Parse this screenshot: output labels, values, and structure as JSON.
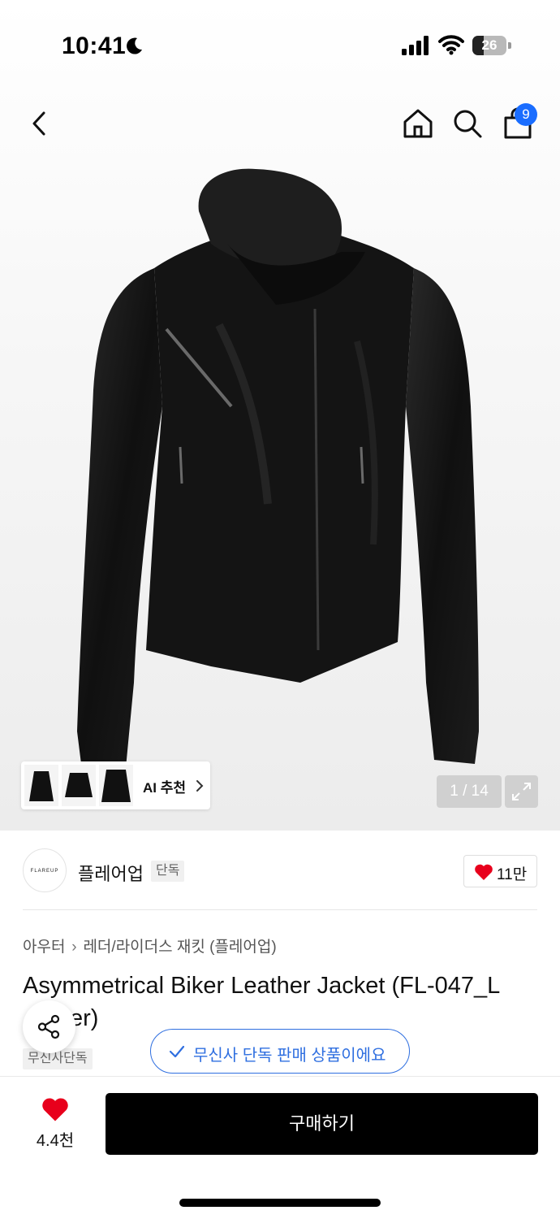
{
  "status_bar": {
    "time": "10:41",
    "battery": "26"
  },
  "nav": {
    "cart_count": "9"
  },
  "gallery": {
    "ai_recommend_label": "AI 추천",
    "page_counter": "1 / 14"
  },
  "brand": {
    "logo_text": "FLAREUP",
    "name": "플레어업",
    "tag": "단독",
    "like_count": "11만"
  },
  "product": {
    "breadcrumb": [
      "아우터",
      "레더/라이더스 재킷 (플레어업)"
    ],
    "title_line1": "Asymmetrical Biker Leather Jacket (FL-047_L",
    "title_line2": "er)",
    "exclusive_tag": "무신사단독"
  },
  "toast": {
    "text": "무신사 단독 판매 상품이에요"
  },
  "bottom_bar": {
    "wish_count": "4.4천",
    "buy_label": "구매하기"
  },
  "colors": {
    "accent_blue": "#2f6fe0",
    "badge_blue": "#1a6dff",
    "heart_red": "#e8001c"
  }
}
